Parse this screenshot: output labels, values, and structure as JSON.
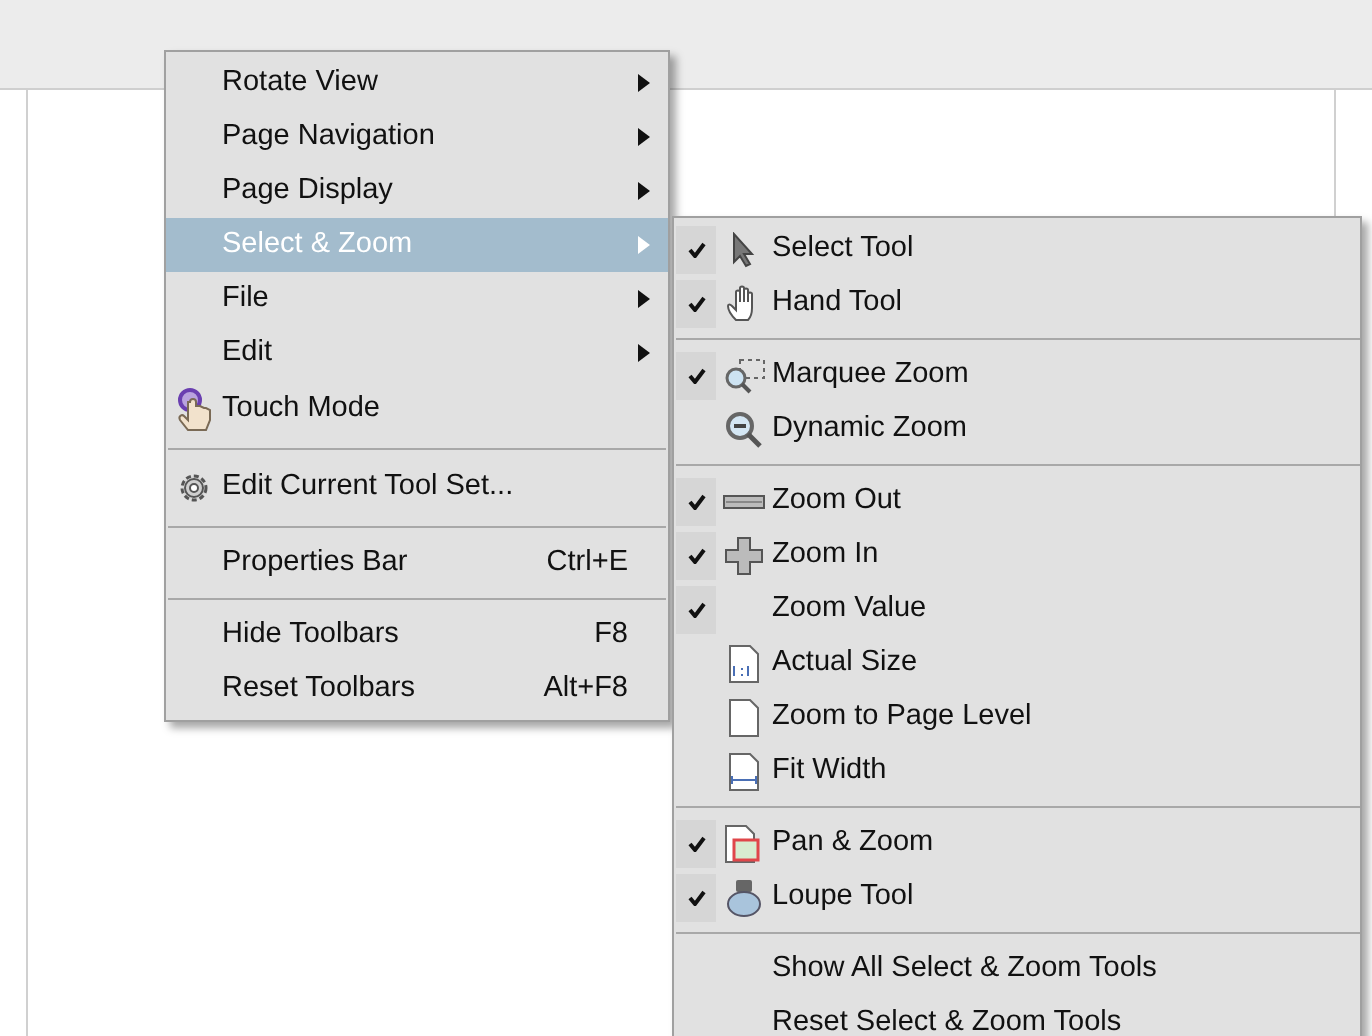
{
  "context_menu": {
    "items": [
      {
        "kind": "submenu",
        "label": "Rotate View",
        "selected": false
      },
      {
        "kind": "submenu",
        "label": "Page Navigation",
        "selected": false
      },
      {
        "kind": "submenu",
        "label": "Page Display",
        "selected": false
      },
      {
        "kind": "submenu",
        "label": "Select & Zoom",
        "selected": true
      },
      {
        "kind": "submenu",
        "label": "File",
        "selected": false
      },
      {
        "kind": "submenu",
        "label": "Edit",
        "selected": false
      },
      {
        "kind": "icon",
        "label": "Touch Mode",
        "selected": false
      },
      {
        "kind": "separator"
      },
      {
        "kind": "icon",
        "label": "Edit Current Tool Set...",
        "selected": false
      },
      {
        "kind": "separator"
      },
      {
        "kind": "command",
        "label": "Properties Bar",
        "shortcut": "Ctrl+E",
        "selected": false
      },
      {
        "kind": "separator"
      },
      {
        "kind": "command",
        "label": "Hide Toolbars",
        "shortcut": "F8",
        "selected": false
      },
      {
        "kind": "command",
        "label": "Reset Toolbars",
        "shortcut": "Alt+F8",
        "selected": false
      }
    ]
  },
  "submenu": {
    "items": [
      {
        "kind": "tool",
        "label": "Select Tool",
        "checked": true
      },
      {
        "kind": "tool",
        "label": "Hand Tool",
        "checked": true
      },
      {
        "kind": "separator"
      },
      {
        "kind": "tool",
        "label": "Marquee Zoom",
        "checked": true
      },
      {
        "kind": "tool",
        "label": "Dynamic Zoom",
        "checked": false
      },
      {
        "kind": "separator"
      },
      {
        "kind": "tool",
        "label": "Zoom Out",
        "checked": true
      },
      {
        "kind": "tool",
        "label": "Zoom In",
        "checked": true
      },
      {
        "kind": "tool",
        "label": "Zoom Value",
        "checked": true
      },
      {
        "kind": "tool",
        "label": "Actual Size",
        "checked": false
      },
      {
        "kind": "tool",
        "label": "Zoom to Page Level",
        "checked": false
      },
      {
        "kind": "tool",
        "label": "Fit Width",
        "checked": false
      },
      {
        "kind": "separator"
      },
      {
        "kind": "tool",
        "label": "Pan & Zoom",
        "checked": true
      },
      {
        "kind": "tool",
        "label": "Loupe Tool",
        "checked": true
      },
      {
        "kind": "separator"
      },
      {
        "kind": "tool",
        "label": "Show All Select & Zoom Tools",
        "checked": false
      },
      {
        "kind": "tool",
        "label": "Reset Select & Zoom Tools",
        "checked": false
      }
    ]
  }
}
